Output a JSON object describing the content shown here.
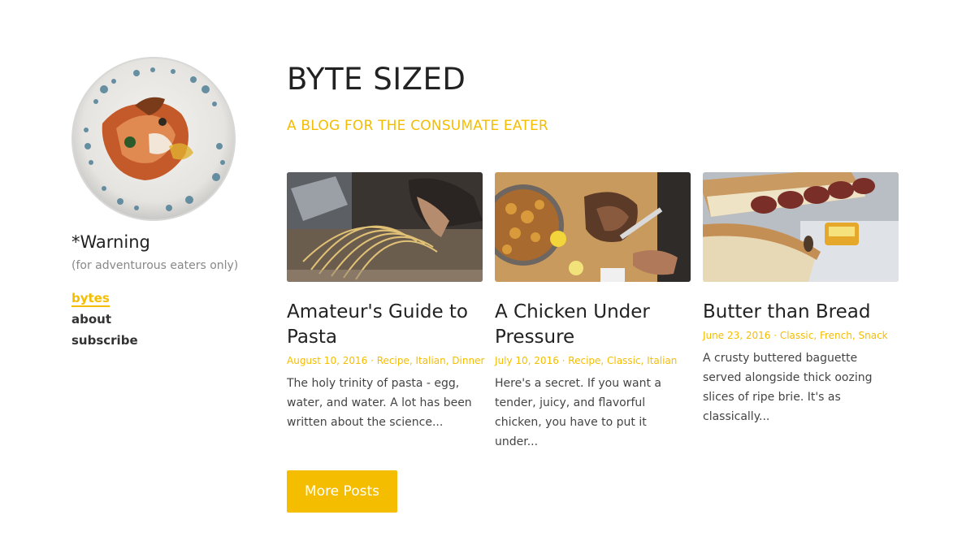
{
  "sidebar": {
    "title": "*Warning",
    "subtitle": "(for adventurous eaters only)",
    "nav": [
      {
        "label": "bytes",
        "active": true
      },
      {
        "label": "about",
        "active": false
      },
      {
        "label": "subscribe",
        "active": false
      }
    ]
  },
  "header": {
    "title": "BYTE SIZED",
    "tagline": "A BLOG FOR THE CONSUMATE EATER"
  },
  "posts": [
    {
      "title": "Amateur's Guide to Pasta",
      "date": "August 10, 2016",
      "categories": "Recipe, Italian, Dinner",
      "excerpt": "The holy trinity of pasta - egg, water, and water. A lot has been written about the science...",
      "image": "pasta-making-photo"
    },
    {
      "title": "A Chicken Under Pressure",
      "date": "July 10, 2016",
      "categories": "Recipe, Classic, Italian",
      "excerpt": "Here's a secret. If you want a tender, juicy, and flavorful chicken, you have to put it under...",
      "image": "roast-chicken-photo"
    },
    {
      "title": "Butter than Bread",
      "date": "June 23, 2016",
      "categories": "Classic, French, Snack",
      "excerpt": "A crusty buttered baguette served alongside thick oozing slices of ripe brie. It's as classically...",
      "image": "baguette-brie-photo"
    }
  ],
  "meta_separator": " · ",
  "more_button": "More Posts",
  "colors": {
    "accent": "#f5bd00",
    "text": "#222222",
    "muted": "#888888"
  }
}
